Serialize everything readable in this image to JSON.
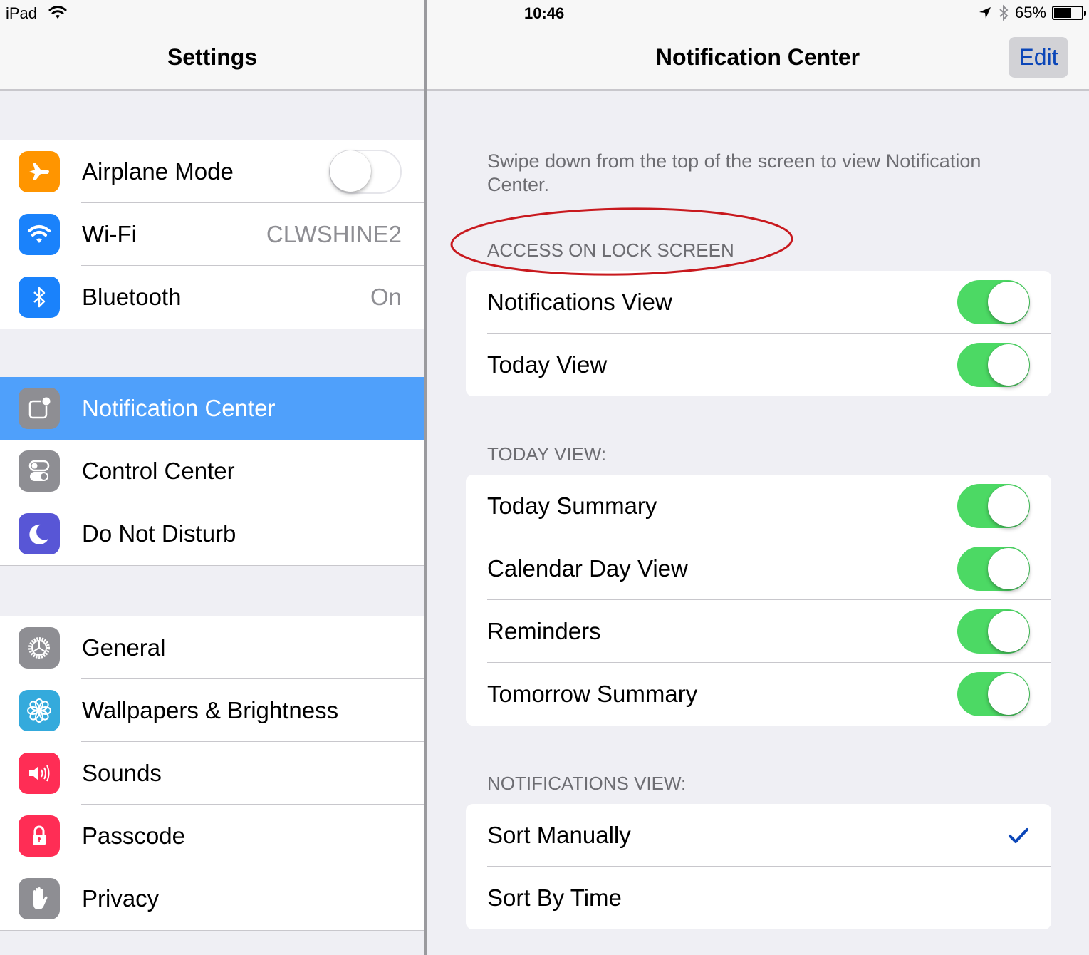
{
  "status_bar": {
    "device": "iPad",
    "time": "10:46",
    "battery_percent_text": "65%",
    "battery_level": 0.65,
    "icons": [
      "wifi-icon",
      "location-arrow-icon",
      "bluetooth-icon",
      "battery-icon"
    ]
  },
  "left_pane": {
    "title": "Settings",
    "groups": [
      {
        "rows": [
          {
            "label": "Airplane Mode",
            "icon": "airplane-icon",
            "icon_color": "#ff9500",
            "control": "toggle",
            "toggle_on": false
          },
          {
            "label": "Wi-Fi",
            "icon": "wifi-icon",
            "icon_color": "#1a82fb",
            "value": "CLWSHINE2"
          },
          {
            "label": "Bluetooth",
            "icon": "bluetooth-icon",
            "icon_color": "#1a82fb",
            "value": "On"
          }
        ]
      },
      {
        "rows": [
          {
            "label": "Notification Center",
            "icon": "notification-center-icon",
            "icon_color": "#8e8e93",
            "selected": true
          },
          {
            "label": "Control Center",
            "icon": "control-center-icon",
            "icon_color": "#8e8e93"
          },
          {
            "label": "Do Not Disturb",
            "icon": "moon-icon",
            "icon_color": "#5856d6"
          }
        ]
      },
      {
        "rows": [
          {
            "label": "General",
            "icon": "gear-icon",
            "icon_color": "#8e8e93"
          },
          {
            "label": "Wallpapers & Brightness",
            "icon": "flower-icon",
            "icon_color": "#34aadc"
          },
          {
            "label": "Sounds",
            "icon": "speaker-icon",
            "icon_color": "#ff2d55"
          },
          {
            "label": "Passcode",
            "icon": "lock-icon",
            "icon_color": "#ff2d55"
          },
          {
            "label": "Privacy",
            "icon": "hand-icon",
            "icon_color": "#8e8e93"
          }
        ]
      }
    ]
  },
  "right_pane": {
    "title": "Notification Center",
    "edit_label": "Edit",
    "note": "Swipe down from the top of the screen to view Notification Center.",
    "sections": [
      {
        "header": "ACCESS ON LOCK SCREEN",
        "highlighted": true,
        "rows": [
          {
            "label": "Notifications View",
            "control": "toggle",
            "toggle_on": true
          },
          {
            "label": "Today View",
            "control": "toggle",
            "toggle_on": true
          }
        ]
      },
      {
        "header": "TODAY VIEW:",
        "rows": [
          {
            "label": "Today Summary",
            "control": "toggle",
            "toggle_on": true
          },
          {
            "label": "Calendar Day View",
            "control": "toggle",
            "toggle_on": true
          },
          {
            "label": "Reminders",
            "control": "toggle",
            "toggle_on": true
          },
          {
            "label": "Tomorrow Summary",
            "control": "toggle",
            "toggle_on": true
          }
        ]
      },
      {
        "header": "NOTIFICATIONS VIEW:",
        "rows": [
          {
            "label": "Sort Manually",
            "control": "check",
            "checked": true
          },
          {
            "label": "Sort By Time",
            "control": "check",
            "checked": false
          }
        ]
      }
    ]
  },
  "colors": {
    "accent_blue": "#0b46b8",
    "selection_blue": "#4fa0fb",
    "toggle_green": "#4cd964",
    "annotation_red": "#c8191e"
  }
}
